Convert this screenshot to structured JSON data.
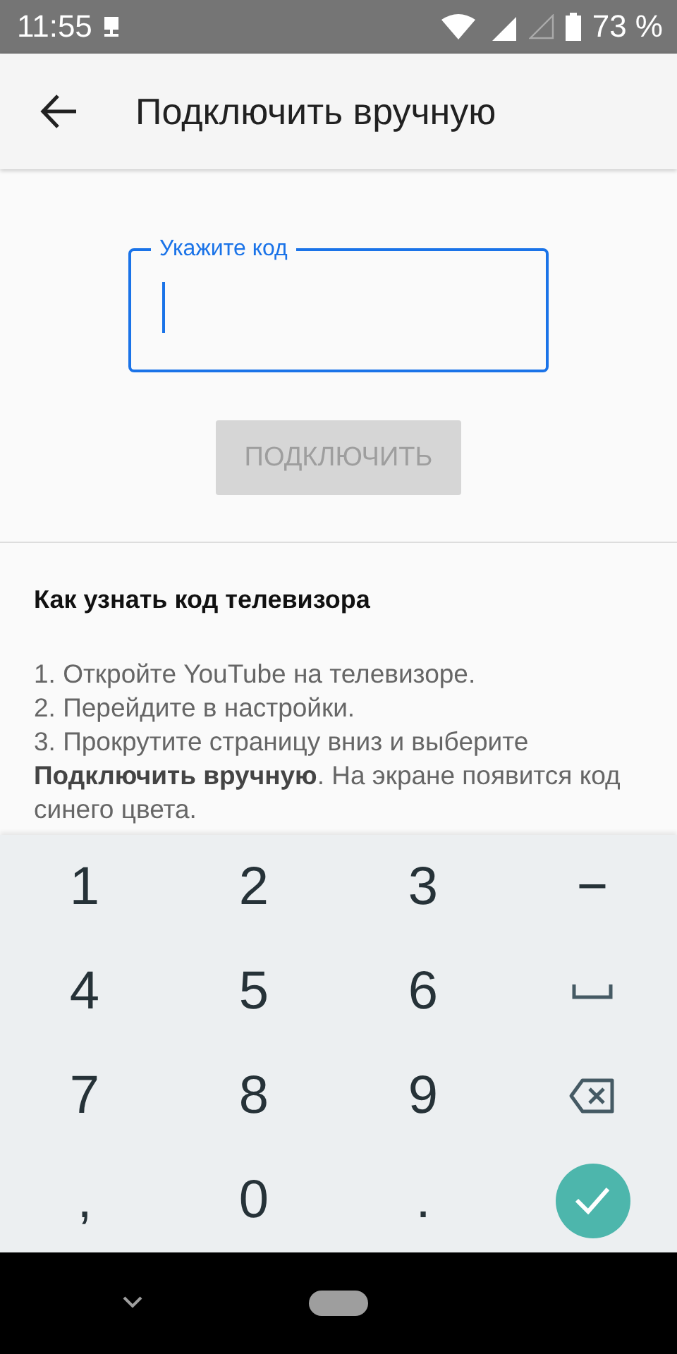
{
  "status_bar": {
    "time": "11:55",
    "battery": "73 %"
  },
  "app_bar": {
    "title": "Подключить вручную"
  },
  "code_field": {
    "label": "Укажите код",
    "focused": true
  },
  "connect_button": {
    "label": "ПОДКЛЮЧИТЬ",
    "disabled": true
  },
  "help": {
    "title": "Как узнать код телевизора",
    "steps": [
      "1. Откройте YouTube на телевизоре.",
      "2. Перейдите в настройки.",
      "3. Прокрутите страницу вниз и выберите **Подключить вручную**. На экране появится код синего цвета."
    ]
  },
  "keyboard": {
    "keys": [
      {
        "kind": "text",
        "label": "1"
      },
      {
        "kind": "text",
        "label": "2"
      },
      {
        "kind": "text",
        "label": "3"
      },
      {
        "kind": "text",
        "label": "−"
      },
      {
        "kind": "text",
        "label": "4"
      },
      {
        "kind": "text",
        "label": "5"
      },
      {
        "kind": "text",
        "label": "6"
      },
      {
        "kind": "space"
      },
      {
        "kind": "text",
        "label": "7"
      },
      {
        "kind": "text",
        "label": "8"
      },
      {
        "kind": "text",
        "label": "9"
      },
      {
        "kind": "backspace"
      },
      {
        "kind": "text",
        "label": ","
      },
      {
        "kind": "text",
        "label": "0"
      },
      {
        "kind": "text",
        "label": "."
      },
      {
        "kind": "done"
      }
    ]
  }
}
